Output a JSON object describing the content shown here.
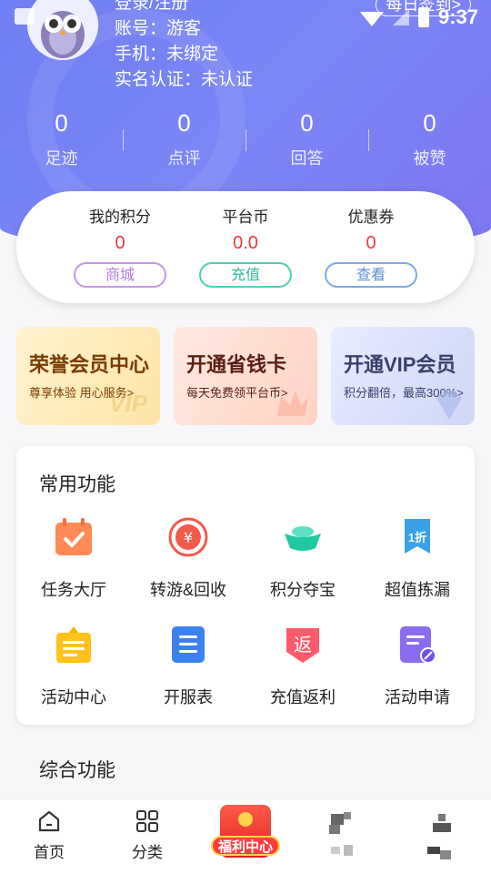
{
  "status_bar": {
    "time": "9:37"
  },
  "user": {
    "name_line": "登录/注册",
    "account_line": "账号：游客",
    "phone_line": "手机：未绑定",
    "realname_line": "实名认证：未认证",
    "signin_label": "每日签到>"
  },
  "stats": [
    {
      "value": "0",
      "label": "足迹"
    },
    {
      "value": "0",
      "label": "点评"
    },
    {
      "value": "0",
      "label": "回答"
    },
    {
      "value": "0",
      "label": "被赞"
    }
  ],
  "points": [
    {
      "title": "我的积分",
      "value": "0",
      "button": "商城",
      "color": "#b57be0"
    },
    {
      "title": "平台币",
      "value": "0.0",
      "button": "充值",
      "color": "#3fbfa5"
    },
    {
      "title": "优惠券",
      "value": "0",
      "button": "查看",
      "color": "#6a9bdc"
    }
  ],
  "promos": [
    {
      "title": "荣誉会员中心",
      "subtitle": "尊享体验 用心服务>",
      "watermark": "VIP",
      "bg": "#ffeec4",
      "color": "#7a3b00"
    },
    {
      "title": "开通省钱卡",
      "subtitle": "每天免费领平台币>",
      "bg": "#ffe1d8",
      "color": "#5a1f12"
    },
    {
      "title": "开通VIP会员",
      "subtitle": "积分翻倍，最高300%>",
      "bg": "#dde3fb",
      "color": "#3b3f6e"
    }
  ],
  "common": {
    "title": "常用功能",
    "items": [
      {
        "label": "任务大厅",
        "icon": "calendar-check-icon"
      },
      {
        "label": "转游&回收",
        "icon": "yen-recycle-icon"
      },
      {
        "label": "积分夺宝",
        "icon": "gold-ingot-icon"
      },
      {
        "label": "超值拣漏",
        "icon": "discount-tag-icon",
        "badge": "1折"
      },
      {
        "label": "活动中心",
        "icon": "event-board-icon"
      },
      {
        "label": "开服表",
        "icon": "server-list-icon"
      },
      {
        "label": "充值返利",
        "icon": "rebate-icon",
        "badge": "返"
      },
      {
        "label": "活动申请",
        "icon": "apply-edit-icon"
      }
    ]
  },
  "general": {
    "title": "综合功能"
  },
  "tabbar": {
    "home": "首页",
    "category": "分类",
    "welfare": "福利中心"
  },
  "colors": {
    "accent": "#7b86f6",
    "value_red": "#e53b3b"
  }
}
